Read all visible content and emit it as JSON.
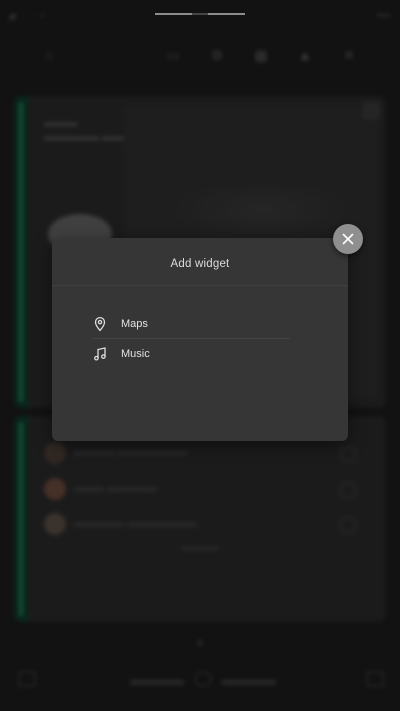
{
  "dialog": {
    "title": "Add widget",
    "options": [
      {
        "label": "Maps",
        "icon": "map-pin-icon"
      },
      {
        "label": "Music",
        "icon": "music-note-icon"
      }
    ],
    "close_icon": "close-icon"
  },
  "colors": {
    "dialog_bg": "#363636",
    "accent_green": "#1f7a56",
    "close_button": "#8f8f8f"
  }
}
